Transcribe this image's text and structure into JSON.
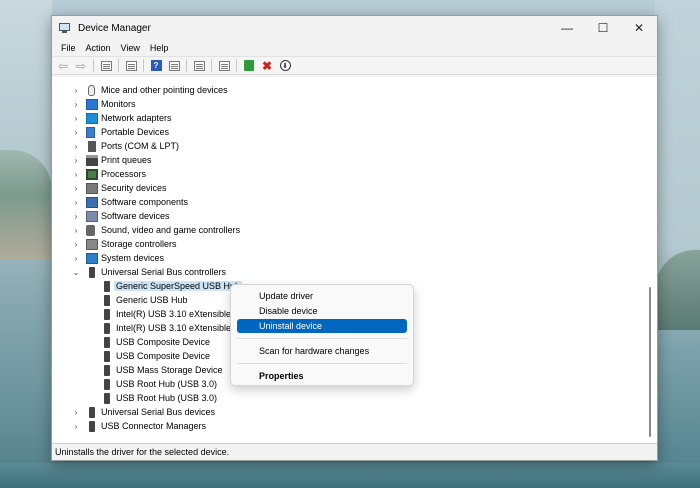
{
  "window": {
    "title": "Device Manager",
    "minimize": "—",
    "maximize": "☐",
    "close": "✕"
  },
  "menu": [
    "File",
    "Action",
    "View",
    "Help"
  ],
  "tree": [
    {
      "label": "Mice and other pointing devices",
      "icon": "mouse-icon",
      "cls": "i-mouse",
      "chev": "›",
      "child": false
    },
    {
      "label": "Monitors",
      "icon": "monitor-icon",
      "cls": "i-monitor",
      "chev": "›",
      "child": false
    },
    {
      "label": "Network adapters",
      "icon": "network-adapter-icon",
      "cls": "i-network",
      "chev": "›",
      "child": false
    },
    {
      "label": "Portable Devices",
      "icon": "portable-device-icon",
      "cls": "i-portable",
      "chev": "›",
      "child": false
    },
    {
      "label": "Ports (COM & LPT)",
      "icon": "port-icon",
      "cls": "i-port",
      "chev": "›",
      "child": false
    },
    {
      "label": "Print queues",
      "icon": "printer-icon",
      "cls": "i-printer",
      "chev": "›",
      "child": false
    },
    {
      "label": "Processors",
      "icon": "processor-icon",
      "cls": "i-proc",
      "chev": "›",
      "child": false
    },
    {
      "label": "Security devices",
      "icon": "security-device-icon",
      "cls": "i-security",
      "chev": "›",
      "child": false
    },
    {
      "label": "Software components",
      "icon": "software-component-icon",
      "cls": "i-swcomp",
      "chev": "›",
      "child": false
    },
    {
      "label": "Software devices",
      "icon": "software-device-icon",
      "cls": "i-swdev",
      "chev": "›",
      "child": false
    },
    {
      "label": "Sound, video and game controllers",
      "icon": "sound-icon",
      "cls": "i-sound",
      "chev": "›",
      "child": false
    },
    {
      "label": "Storage controllers",
      "icon": "storage-icon",
      "cls": "i-storage",
      "chev": "›",
      "child": false
    },
    {
      "label": "System devices",
      "icon": "system-device-icon",
      "cls": "i-system",
      "chev": "›",
      "child": false
    },
    {
      "label": "Universal Serial Bus controllers",
      "icon": "usb-icon",
      "cls": "i-usb",
      "chev": "⌄",
      "child": false
    },
    {
      "label": "Generic SuperSpeed USB Hub",
      "icon": "usb-icon",
      "cls": "i-usb",
      "chev": "",
      "child": true,
      "selected": true
    },
    {
      "label": "Generic USB Hub",
      "icon": "usb-icon",
      "cls": "i-usb",
      "chev": "",
      "child": true
    },
    {
      "label": "Intel(R) USB 3.10 eXtensible",
      "icon": "usb-icon",
      "cls": "i-usb",
      "chev": "",
      "child": true
    },
    {
      "label": "Intel(R) USB 3.10 eXtensible",
      "icon": "usb-icon",
      "cls": "i-usb",
      "chev": "",
      "child": true
    },
    {
      "label": "USB Composite Device",
      "icon": "usb-icon",
      "cls": "i-usb",
      "chev": "",
      "child": true
    },
    {
      "label": "USB Composite Device",
      "icon": "usb-icon",
      "cls": "i-usb",
      "chev": "",
      "child": true
    },
    {
      "label": "USB Mass Storage Device",
      "icon": "usb-icon",
      "cls": "i-usb",
      "chev": "",
      "child": true
    },
    {
      "label": "USB Root Hub (USB 3.0)",
      "icon": "usb-icon",
      "cls": "i-usb",
      "chev": "",
      "child": true
    },
    {
      "label": "USB Root Hub (USB 3.0)",
      "icon": "usb-icon",
      "cls": "i-usb",
      "chev": "",
      "child": true
    },
    {
      "label": "Universal Serial Bus devices",
      "icon": "usb-icon",
      "cls": "i-usb",
      "chev": "›",
      "child": false
    },
    {
      "label": "USB Connector Managers",
      "icon": "usb-connector-icon",
      "cls": "i-connector",
      "chev": "›",
      "child": false
    }
  ],
  "context_menu": {
    "update_driver": "Update driver",
    "disable_device": "Disable device",
    "uninstall_device": "Uninstall device",
    "scan_hardware": "Scan for hardware changes",
    "properties": "Properties"
  },
  "status": "Uninstalls the driver for the selected device."
}
